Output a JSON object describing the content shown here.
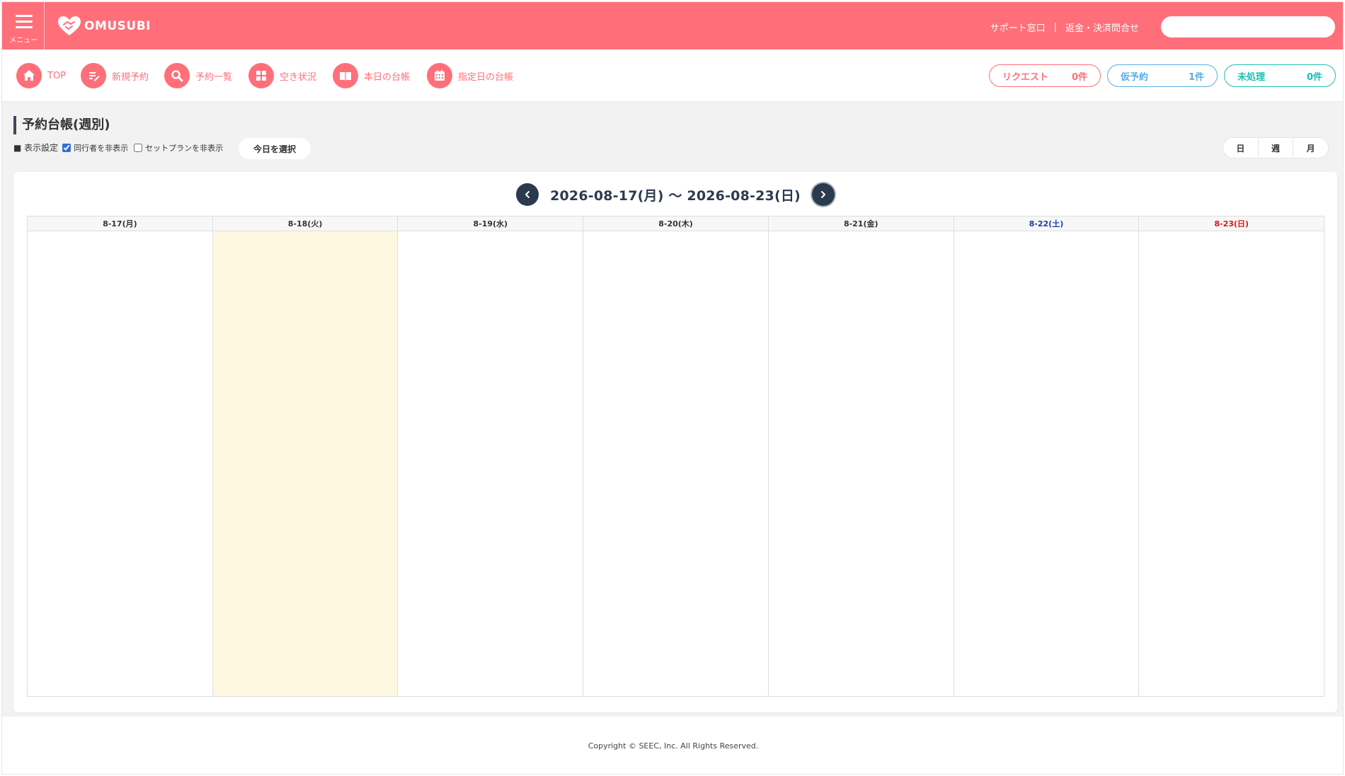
{
  "header": {
    "menu_label": "メニュー",
    "logo_text": "OMUSUBI",
    "links": [
      "サポート窓口",
      "返金・決済問合せ"
    ],
    "separator": "|",
    "search_placeholder": ""
  },
  "nav": {
    "items": [
      {
        "label": "TOP",
        "icon": "home-icon"
      },
      {
        "label": "新規予約",
        "icon": "edit-icon"
      },
      {
        "label": "予約一覧",
        "icon": "search-icon"
      },
      {
        "label": "空き状況",
        "icon": "grid-icon"
      },
      {
        "label": "本日の台帳",
        "icon": "book-icon"
      },
      {
        "label": "指定日の台帳",
        "icon": "calendar-icon"
      }
    ]
  },
  "status": {
    "request": {
      "label": "リクエスト",
      "count": "0件"
    },
    "temp": {
      "label": "仮予約",
      "count": "1件"
    },
    "unprocessed": {
      "label": "未処理",
      "count": "0件"
    }
  },
  "page": {
    "title": "予約台帳(週別)",
    "display_settings_label": "■ 表示設定",
    "hide_companions_label": "同行者を非表示",
    "hide_companions_checked": true,
    "hide_setplan_label": "セットプランを非表示",
    "hide_setplan_checked": false,
    "today_button": "今日を選択",
    "view_options": [
      "日",
      "週",
      "月"
    ]
  },
  "calendar": {
    "range_text": "2026-08-17(月) 〜 2026-08-23(日)",
    "days": [
      {
        "label": "8-17(月)",
        "type": "weekday",
        "today": false
      },
      {
        "label": "8-18(火)",
        "type": "weekday",
        "today": true
      },
      {
        "label": "8-19(水)",
        "type": "weekday",
        "today": false
      },
      {
        "label": "8-20(木)",
        "type": "weekday",
        "today": false
      },
      {
        "label": "8-21(金)",
        "type": "weekday",
        "today": false
      },
      {
        "label": "8-22(土)",
        "type": "saturday",
        "today": false
      },
      {
        "label": "8-23(日)",
        "type": "sunday",
        "today": false
      }
    ]
  },
  "colors": {
    "brand": "#fe6f7a",
    "request": "#fe6f7a",
    "temp": "#5aaee6",
    "unprocessed": "#1bbfb2",
    "today_highlight": "#fff8e0",
    "saturday": "#1d3fa0",
    "sunday": "#e11414"
  },
  "footer": {
    "copyright": "Copyright © SEEC, Inc. All Rights Reserved."
  }
}
